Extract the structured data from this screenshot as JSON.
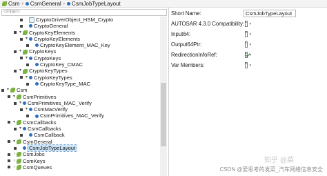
{
  "breadcrumb": {
    "items": [
      {
        "icon": "leaf-icon",
        "label": "Csm"
      },
      {
        "icon": "element-icon",
        "label": "CsmGeneral"
      },
      {
        "icon": "element-icon",
        "label": "CsmJobTypeLayout"
      }
    ]
  },
  "filter": {
    "placeholder": "<Filter>"
  },
  "tree": {
    "rows": [
      {
        "indent": 3,
        "twisty": "",
        "icon": "small",
        "label": "CryptoDriverObject_HSM_Crypto",
        "sel": false
      },
      {
        "indent": 3,
        "twisty": "",
        "icon": "elem",
        "label": "CryptoGeneral",
        "sel": false
      },
      {
        "indent": 2,
        "twisty": "▾",
        "icon": "leaf",
        "label": "CryptoKeyElements",
        "sel": false
      },
      {
        "indent": 3,
        "twisty": "▾",
        "icon": "elem",
        "label": "CryptoKeyElements",
        "sel": false
      },
      {
        "indent": 4,
        "twisty": "",
        "icon": "elem",
        "label": "CryptoKeyElement_MAC_Key",
        "sel": false
      },
      {
        "indent": 2,
        "twisty": "▾",
        "icon": "leaf",
        "label": "CryptoKeys",
        "sel": false
      },
      {
        "indent": 3,
        "twisty": "▾",
        "icon": "elem",
        "label": "CryptoKeys",
        "sel": false
      },
      {
        "indent": 4,
        "twisty": "",
        "icon": "elem",
        "label": "CryptoKey_CMAC",
        "sel": false
      },
      {
        "indent": 2,
        "twisty": "▾",
        "icon": "leaf",
        "label": "CryptoKeyTypes",
        "sel": false
      },
      {
        "indent": 3,
        "twisty": "▾",
        "icon": "elem",
        "label": "CryptoKeyTypes",
        "sel": false
      },
      {
        "indent": 4,
        "twisty": "",
        "icon": "elem",
        "label": "CryptoKeyType_MAC",
        "sel": false
      },
      {
        "indent": 0,
        "twisty": "▾",
        "icon": "leaf",
        "label": "Csm",
        "sel": false
      },
      {
        "indent": 1,
        "twisty": "▾",
        "icon": "leaf",
        "label": "CsmPrimitives",
        "sel": false
      },
      {
        "indent": 2,
        "twisty": "▾",
        "icon": "elem",
        "label": "CsmPrimitives_MAC_Verify",
        "sel": false
      },
      {
        "indent": 3,
        "twisty": "▾",
        "icon": "elem",
        "label": "CsmMacVerify",
        "sel": false
      },
      {
        "indent": 4,
        "twisty": "",
        "icon": "elem",
        "label": "CsmPrimitives_MAC_Verify",
        "sel": false
      },
      {
        "indent": 1,
        "twisty": "▾",
        "icon": "leaf",
        "label": "CsmCallbacks",
        "sel": false
      },
      {
        "indent": 2,
        "twisty": "▾",
        "icon": "elem",
        "label": "CsmCallbacks",
        "sel": false
      },
      {
        "indent": 3,
        "twisty": "",
        "icon": "elem",
        "label": "CsmCallback",
        "sel": false
      },
      {
        "indent": 1,
        "twisty": "▾",
        "icon": "leaf",
        "label": "CsmGeneral",
        "sel": false
      },
      {
        "indent": 2,
        "twisty": "",
        "icon": "elem",
        "label": "CsmJobTypeLayout",
        "sel": true
      },
      {
        "indent": 1,
        "twisty": "›",
        "icon": "leaf",
        "label": "CsmJobs",
        "sel": false
      },
      {
        "indent": 1,
        "twisty": "›",
        "icon": "leaf",
        "label": "CsmKeys",
        "sel": false
      },
      {
        "indent": 1,
        "twisty": "›",
        "icon": "leaf",
        "label": "CsmQueues",
        "sel": false
      }
    ]
  },
  "properties": {
    "short_name_label": "Short Name:",
    "short_name_value": "CsmJobTypeLayout",
    "items": [
      {
        "label": "AUTOSAR 4.3.0 Compatibility:",
        "checked": false
      },
      {
        "label": "Input64:",
        "checked": false
      },
      {
        "label": "Output64Ptr:",
        "checked": false
      },
      {
        "label": "RedirectionInfoRef:",
        "checked": true
      },
      {
        "label": "Var Members:",
        "checked": false
      }
    ]
  },
  "watermark": {
    "text": "CSDN @爱思考的发菜_汽车网络信息安全",
    "logo": "知乎 @菜"
  }
}
